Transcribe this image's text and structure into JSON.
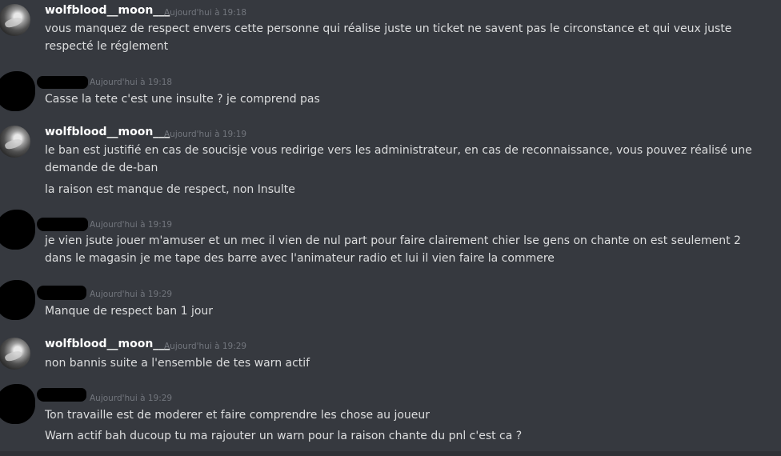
{
  "messages": [
    {
      "author": "wolfblood__moon___",
      "timestamp": "Aujourd'hui à 19:18",
      "lines": [
        "vous manquez de respect envers cette personne qui réalise juste un ticket ne savent pas le circonstance et qui veux juste respecté le réglement"
      ]
    },
    {
      "author": "",
      "timestamp": "Aujourd'hui à 19:18",
      "lines": [
        "Casse la tete c'est une insulte ? je comprend pas"
      ]
    },
    {
      "author": "wolfblood__moon___",
      "timestamp": "Aujourd'hui à 19:19",
      "lines": [
        "le ban est justifié en cas de soucisje vous redirige vers les administrateur, en cas de reconnaissance, vous pouvez réalisé une demande de de-ban",
        "la raison est manque de respect, non Insulte"
      ]
    },
    {
      "author": "",
      "timestamp": "Aujourd'hui à 19:19",
      "lines": [
        "je vien jsute jouer m'amuser et un mec il vien de nul part pour faire clairement chier lse gens on chante on est seulement 2 dans le magasin je me tape des barre avec l'animateur radio et lui il vien faire la commere"
      ]
    },
    {
      "author": "",
      "timestamp": "Aujourd'hui à 19:29",
      "lines": [
        "Manque de respect ban 1 jour"
      ]
    },
    {
      "author": "wolfblood__moon___",
      "timestamp": "Aujourd'hui à 19:29",
      "lines": [
        "non bannis suite a l'ensemble de tes warn actif"
      ]
    },
    {
      "author": "",
      "timestamp": "Aujourd'hui à 19:29",
      "lines": [
        "Ton travaille est de moderer et faire comprendre les chose au joueur",
        "Warn actif bah ducoup tu ma rajouter un warn pour la raison chante du pnl c'est ca ?"
      ]
    }
  ]
}
